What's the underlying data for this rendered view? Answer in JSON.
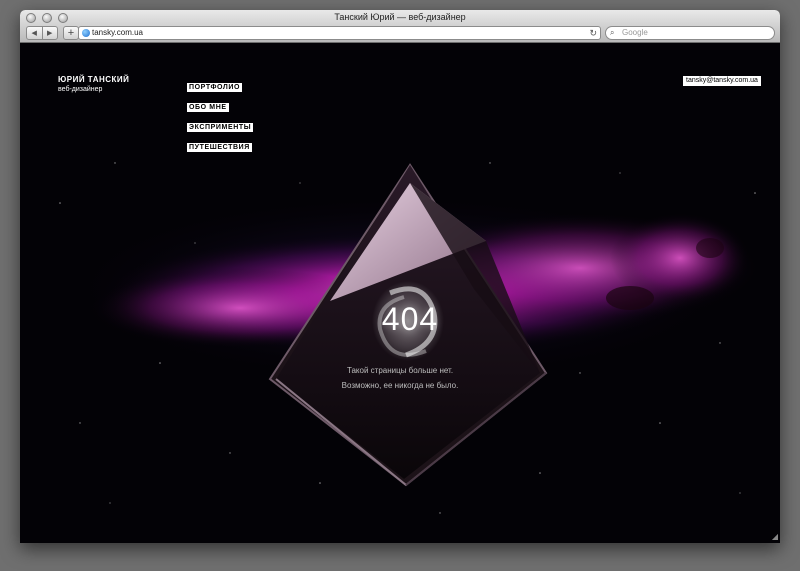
{
  "browser": {
    "title": "Танский Юрий — веб-дизайнер",
    "url": "tansky.com.ua",
    "search_placeholder": "Google",
    "back_glyph": "◀",
    "forward_glyph": "▶",
    "add_glyph": "+",
    "reload_glyph": "↻",
    "search_glyph": "⌕"
  },
  "header": {
    "name": "ЮРИЙ ТАНСКИЙ",
    "subtitle": "веб-дизайнер",
    "email": "tansky@tansky.com.ua"
  },
  "nav": {
    "items": [
      {
        "label": "Портфолио"
      },
      {
        "label": "Обо мне"
      },
      {
        "label": "Эксприменты"
      },
      {
        "label": "Путешествия"
      }
    ]
  },
  "error": {
    "code": "404",
    "line1": "Такой страницы больше нет.",
    "line2": "Возможно, ее никогда не было."
  },
  "colors": {
    "background": "#030206",
    "nebula": "#c21bb2",
    "text": "#ffffff",
    "message": "#bdbdbd"
  }
}
